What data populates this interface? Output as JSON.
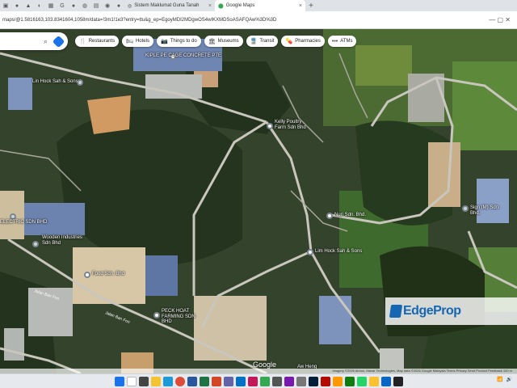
{
  "browser": {
    "tabs": [
      {
        "title": "Sistem Maklumat Guna Tanah",
        "active": false
      },
      {
        "title": "Google Maps",
        "active": true
      }
    ],
    "new_tab": "+",
    "url": "maps/@1.5816163,103.8341604,1058m/data=!3m1!1e3?entry=ttu&g_ep=EgoyMDI2MDgwOS4wIKXMDSoASAFQAw%3D%3D"
  },
  "search": {
    "search_icon": "search-icon",
    "directions_icon": "directions-icon"
  },
  "chips": [
    {
      "label": "Restaurants",
      "icon": "fork-knife-icon",
      "glyph": "🍴"
    },
    {
      "label": "Hotels",
      "icon": "bed-icon",
      "glyph": "🛏"
    },
    {
      "label": "Things to do",
      "icon": "camera-icon",
      "glyph": "📷"
    },
    {
      "label": "Museums",
      "icon": "museum-icon",
      "glyph": "🏛"
    },
    {
      "label": "Transit",
      "icon": "train-icon",
      "glyph": "🚆"
    },
    {
      "label": "Pharmacies",
      "icon": "pharmacy-icon",
      "glyph": "💊"
    },
    {
      "label": "ATMs",
      "icon": "atm-icon",
      "glyph": "•••"
    }
  ],
  "pois": [
    "KIPLE PE CAGE CONCRETE PTE",
    "Kelly Poultry Farm Sdn Bhd",
    "Nuri Sdn. Bhd.",
    "Lim Hock Sah & Sons",
    "Lin Hock Sah & Sons",
    "PECK HOAT FARMING SDN BHD",
    "Wooden Industries Sdn Bhd",
    "Food Sdn. Bhd",
    "ELECTRIC SDN BHD",
    "Sign (M) Sdn. Bhd.",
    "Aw Heng"
  ],
  "roads": [
    "Jalan Ban Foo",
    "Jalan Ban Foo"
  ],
  "watermark": "EdgeProp",
  "google_logo": "Google",
  "attribution": "Imagery ©2026 Airbus, Maxar Technologies, Map data ©2026 Google   Malaysia   Terms   Privacy   Send Product Feedback   100 m",
  "colors": {
    "forest": "#24341e",
    "plantation": "#3d5a2c",
    "field": "#6f8c3d",
    "bare_soil": "#d29a63",
    "roof_blue": "#6f86b3",
    "roof_gray": "#b9bcb8",
    "road": "#c8c6bd",
    "brand": "#1567b3"
  },
  "taskbar_apps": [
    "start",
    "search",
    "task-view",
    "files",
    "edge",
    "chrome",
    "word",
    "excel",
    "powerpoint",
    "teams",
    "outlook",
    "photos",
    "maps",
    "calculator",
    "onenote",
    "settings",
    "photoshop",
    "acrobat",
    "illustrator",
    "xbox",
    "whatsapp",
    "notes",
    "store",
    "terminal"
  ]
}
